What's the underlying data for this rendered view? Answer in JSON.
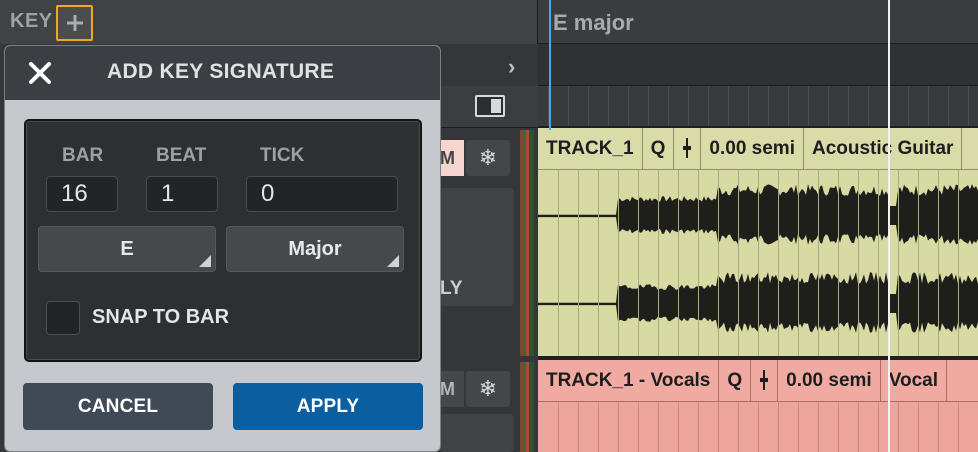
{
  "key_lane": {
    "label": "KEY",
    "current_key": "E major"
  },
  "dialog": {
    "title": "ADD KEY SIGNATURE",
    "fields": {
      "bar_label": "BAR",
      "beat_label": "BEAT",
      "tick_label": "TICK",
      "bar_value": "16",
      "beat_value": "1",
      "tick_value": "0"
    },
    "key_select": "E",
    "scale_select": "Major",
    "snap_label": "SNAP TO BAR",
    "snap_checked": false,
    "cancel_label": "CANCEL",
    "apply_label": "APPLY"
  },
  "tracks": [
    {
      "name": "TRACK_1",
      "quantize": "Q",
      "transpose": "0.00 semi",
      "instrument": "Acoustic Guitar",
      "color": "#d7dba3",
      "header_fragment_m": "M",
      "header_fragment_ly": "LY"
    },
    {
      "name": "TRACK_1 - Vocals",
      "quantize": "Q",
      "transpose": "0.00 semi",
      "instrument": "Vocal",
      "color": "#eda49c",
      "header_fragment_m": "M"
    }
  ],
  "colors": {
    "highlight_border": "#f0a81c",
    "apply_button": "#0b5fa0",
    "cancel_button": "#3f4a56",
    "playhead": "#4aa8e8"
  }
}
